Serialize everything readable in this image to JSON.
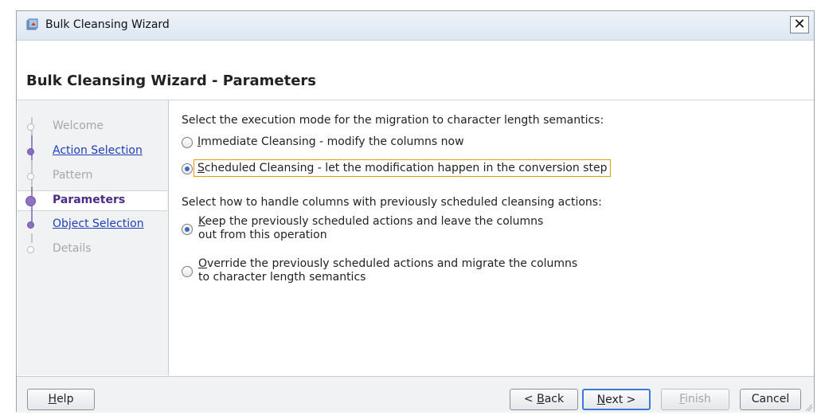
{
  "window": {
    "title": "Bulk Cleansing Wizard",
    "close_symbol": "✕"
  },
  "header": {
    "title": "Bulk Cleansing Wizard - Parameters"
  },
  "steps": [
    {
      "label": "Welcome",
      "state": "disabled"
    },
    {
      "label": "Action Selection",
      "state": "link"
    },
    {
      "label": "Pattern",
      "state": "disabled"
    },
    {
      "label": "Parameters",
      "state": "current"
    },
    {
      "label": "Object Selection",
      "state": "link"
    },
    {
      "label": "Details",
      "state": "disabled"
    }
  ],
  "execution": {
    "prompt": "Select the execution mode for the migration to character length semantics:",
    "options": [
      {
        "mnemonic": "I",
        "rest": "mmediate Cleansing - modify the columns now",
        "selected": false
      },
      {
        "mnemonic": "S",
        "rest": "cheduled Cleansing - let the modification happen in the conversion step",
        "selected": true
      }
    ]
  },
  "handling": {
    "prompt": "Select how to handle columns with previously scheduled cleansing actions:",
    "options": [
      {
        "mnemonic": "K",
        "line1_rest": "eep the previously scheduled actions and leave the columns",
        "line2": "out from this operation",
        "selected": true
      },
      {
        "mnemonic": "O",
        "line1_rest": "verride the previously scheduled actions and migrate the columns",
        "line2": "to character length semantics",
        "selected": false
      }
    ]
  },
  "footer": {
    "help": {
      "mnemonic": "H",
      "rest": "elp"
    },
    "back": {
      "prefix": "< ",
      "mnemonic": "B",
      "rest": "ack"
    },
    "next": {
      "mnemonic": "N",
      "rest": "ext >"
    },
    "finish": {
      "mnemonic": "F",
      "rest": "inish"
    },
    "cancel": "Cancel"
  }
}
